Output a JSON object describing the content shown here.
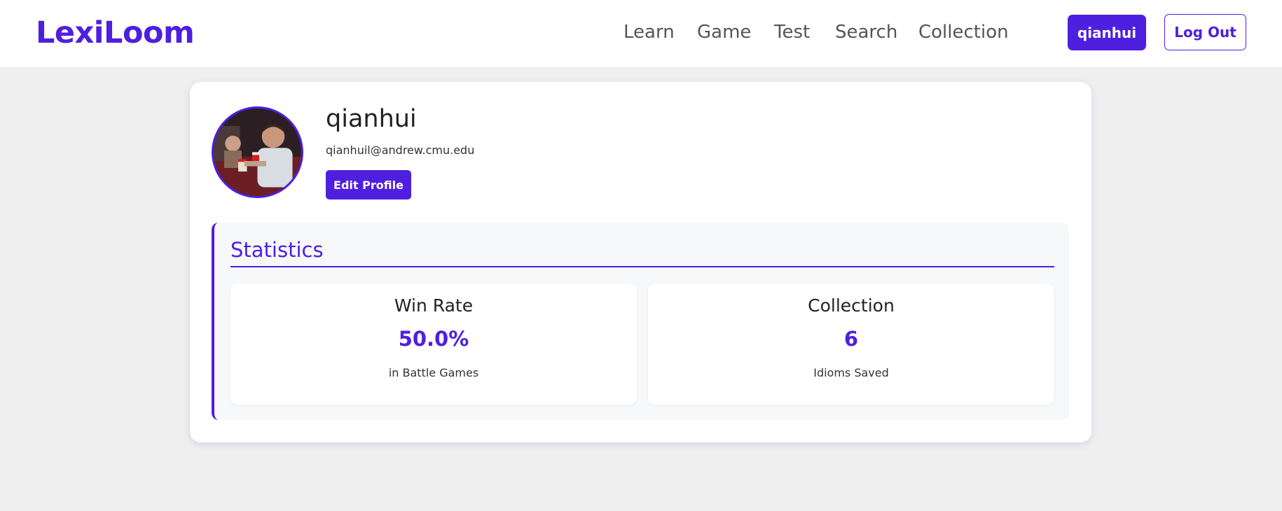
{
  "header": {
    "logo": "LexiLoom",
    "nav": [
      "Learn",
      "Game",
      "Test",
      "Search",
      "Collection"
    ],
    "user_button": "qianhui",
    "logout_button": "Log Out"
  },
  "profile": {
    "username": "qianhui",
    "email": "qianhuil@andrew.cmu.edu",
    "edit_button": "Edit Profile"
  },
  "statistics": {
    "title": "Statistics",
    "win_rate": {
      "label": "Win Rate",
      "value": "50.0%",
      "sub": "in Battle Games"
    },
    "collection": {
      "label": "Collection",
      "value": "6",
      "sub": "Idioms Saved"
    }
  },
  "colors": {
    "accent": "#4f1fe0",
    "background": "#efefef"
  }
}
